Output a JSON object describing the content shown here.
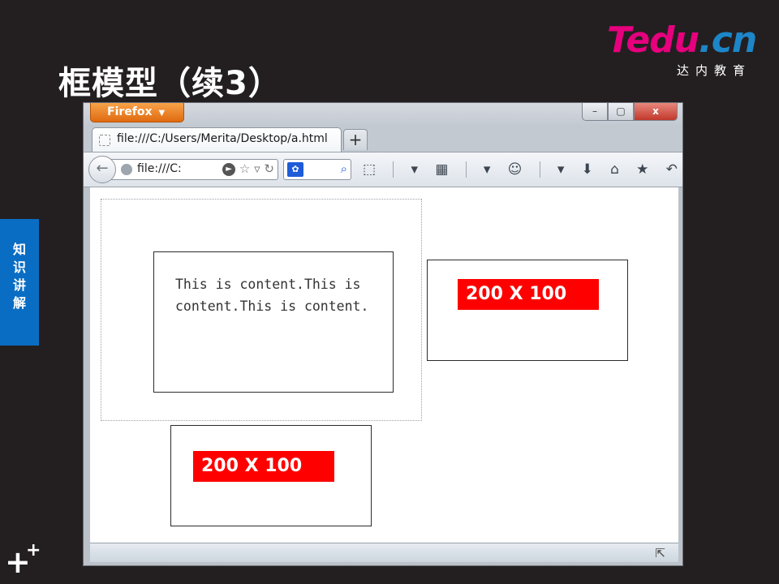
{
  "slide": {
    "title": "框模型（续3）",
    "logo_brand": "Tedu",
    "logo_domain": ".cn",
    "logo_subtitle": "达内教育",
    "side_tab": [
      "知",
      "识",
      "讲",
      "解"
    ],
    "plus_big": "+",
    "plus_small": "+"
  },
  "browser": {
    "app_button_label": "Firefox",
    "window_controls": {
      "minimize": "–",
      "maximize": "▢",
      "close": "x"
    },
    "tab": {
      "title": "file:///C:/Users/Merita/Desktop/a.html"
    },
    "new_tab_label": "+",
    "url": {
      "value": "file:///C:"
    },
    "toolbar_icons": [
      "screenshot-icon",
      "dropdown-arrow-icon",
      "addons-icon",
      "dropdown-arrow-icon",
      "smiley-icon",
      "dropdown-arrow-icon",
      "download-icon",
      "home-icon",
      "bookmarks-icon",
      "undo-icon"
    ]
  },
  "page": {
    "content_text": "This is content.This is content.This is content.",
    "box_right_label": "200 X 100",
    "box_bottom_label": "200 X 100"
  },
  "colors": {
    "background": "#231f20",
    "accent_blue": "#0a6dc4",
    "label_red": "#ff0000",
    "logo_magenta": "#e6007e"
  }
}
